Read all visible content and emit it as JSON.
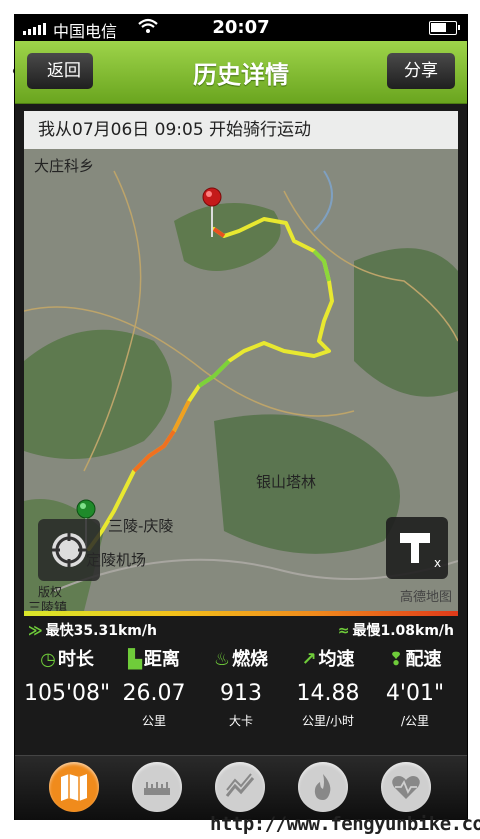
{
  "status_bar": {
    "carrier": "中国电信",
    "time": "20:07"
  },
  "nav": {
    "back": "返回",
    "title": "历史详情",
    "share": "分享"
  },
  "map": {
    "banner": "我从07月06日 09:05 开始骑行运动",
    "places": [
      "大庄科乡",
      "银山塔林",
      "三陵-庆陵",
      "定陵机场",
      "版权",
      "三陵镇"
    ],
    "copyright": "高德地图"
  },
  "speed": {
    "fastest": "最快35.31km/h",
    "slowest": "最慢1.08km/h"
  },
  "stats": [
    {
      "label": "时长",
      "value": "105'08\"",
      "unit": "",
      "icon": "clock-icon"
    },
    {
      "label": "距离",
      "value": "26.07",
      "unit": "公里",
      "icon": "ruler-icon"
    },
    {
      "label": "燃烧",
      "value": "913",
      "unit": "大卡",
      "icon": "flame-icon"
    },
    {
      "label": "均速",
      "value": "14.88",
      "unit": "公里/小时",
      "icon": "trend-icon"
    },
    {
      "label": "配速",
      "value": "4'01\"",
      "unit": "/公里",
      "icon": "footprints-icon"
    }
  ],
  "tabs": [
    "map-icon",
    "ruler-icon",
    "speed-chart-icon",
    "flame-icon",
    "heart-rate-icon"
  ],
  "footer": {
    "url": "http://www.fengyunbike.com"
  },
  "colors": {
    "accent": "#7cba2a",
    "track_fast": "#e8f22a",
    "track_slow": "#e03a1a"
  }
}
